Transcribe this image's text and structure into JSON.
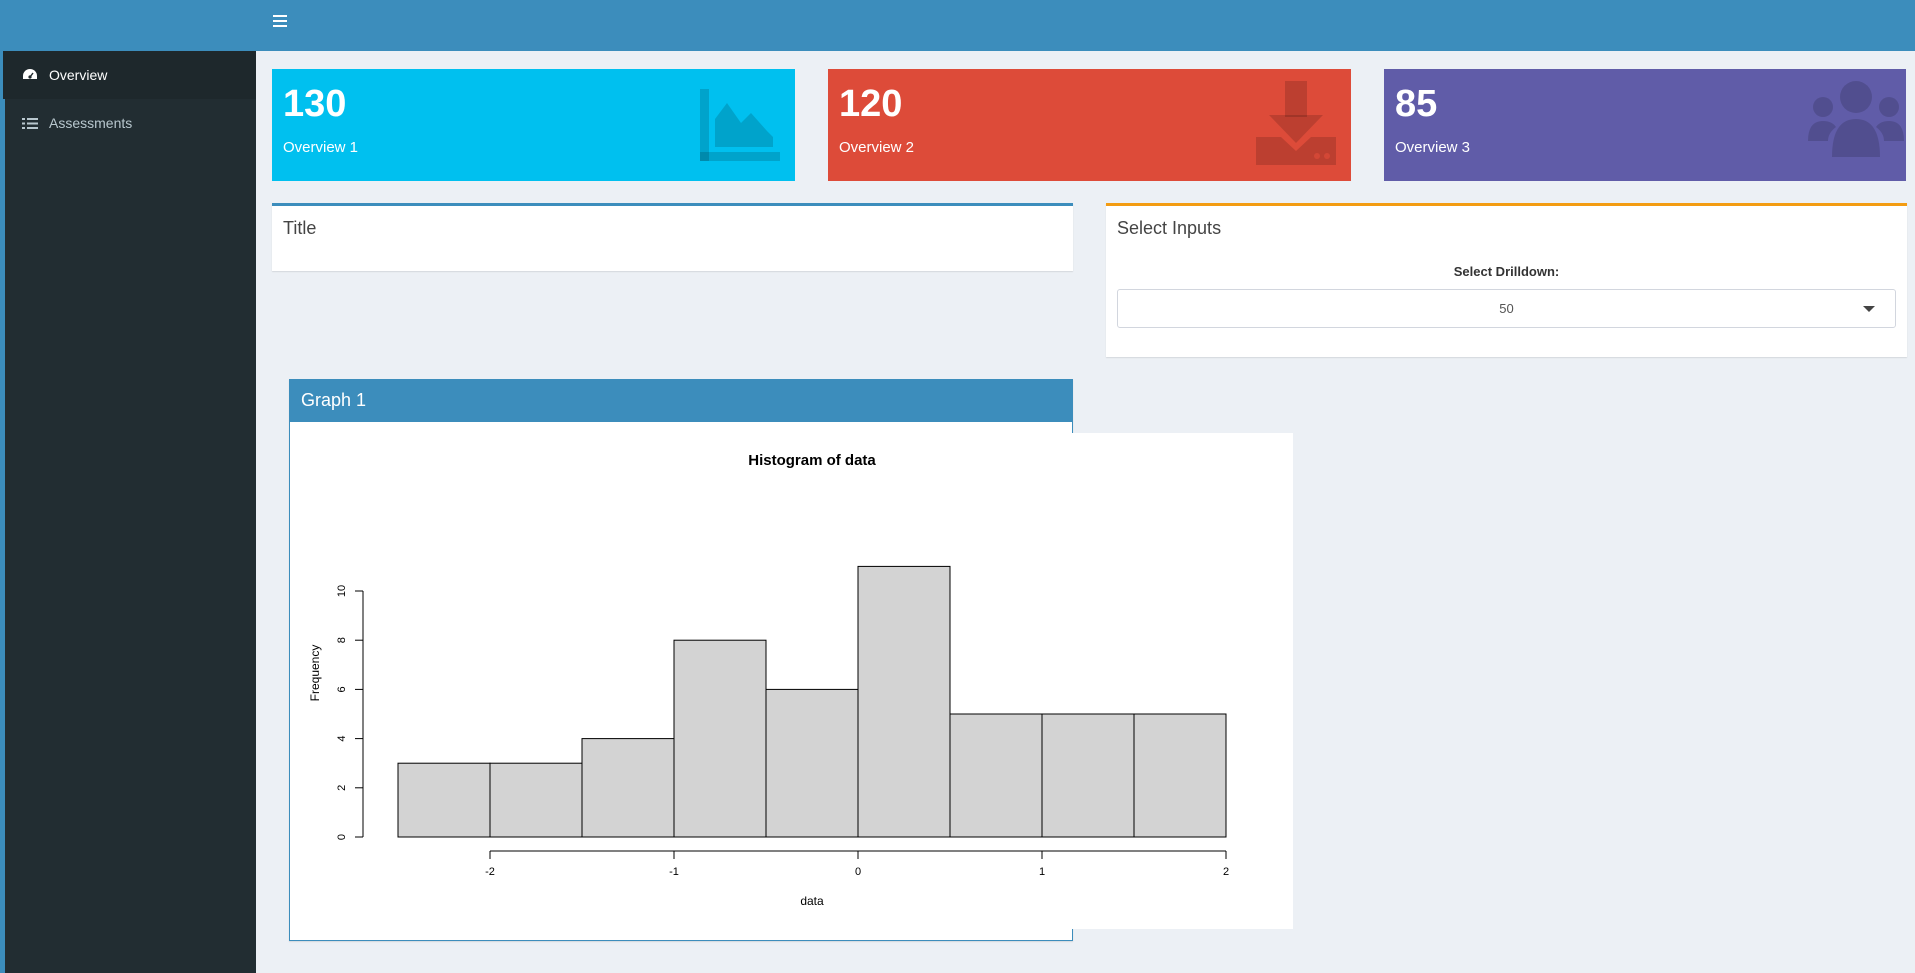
{
  "sidebar": {
    "items": [
      {
        "label": "Overview",
        "icon": "dashboard-icon",
        "active": true
      },
      {
        "label": "Assessments",
        "icon": "list-icon",
        "active": false
      }
    ]
  },
  "value_boxes": [
    {
      "value": "130",
      "label": "Overview 1",
      "icon": "area-chart-icon",
      "color": "#00c0ef"
    },
    {
      "value": "120",
      "label": "Overview 2",
      "icon": "download-icon",
      "color": "#dd4b39"
    },
    {
      "value": "85",
      "label": "Overview 3",
      "icon": "users-icon",
      "color": "#605ca8"
    }
  ],
  "title_box": {
    "title": "Title"
  },
  "inputs_box": {
    "title": "Select Inputs",
    "select_label": "Select Drilldown:",
    "select_value": "50"
  },
  "graph_box": {
    "title": "Graph 1"
  },
  "chart_data": {
    "type": "bar",
    "title": "Histogram of data",
    "xlabel": "data",
    "ylabel": "Frequency",
    "bin_edges": [
      -2.5,
      -2.0,
      -1.5,
      -1.0,
      -0.5,
      0.0,
      0.5,
      1.0,
      1.5,
      2.0
    ],
    "values": [
      3,
      3,
      4,
      8,
      6,
      11,
      5,
      5,
      5
    ],
    "xticks": [
      -2,
      -1,
      0,
      1,
      2
    ],
    "yticks": [
      0,
      2,
      4,
      6,
      8,
      10
    ],
    "xlim": [
      -2.5,
      2.0
    ],
    "ylim": [
      0,
      11
    ],
    "bar_color": "#d3d3d3"
  }
}
